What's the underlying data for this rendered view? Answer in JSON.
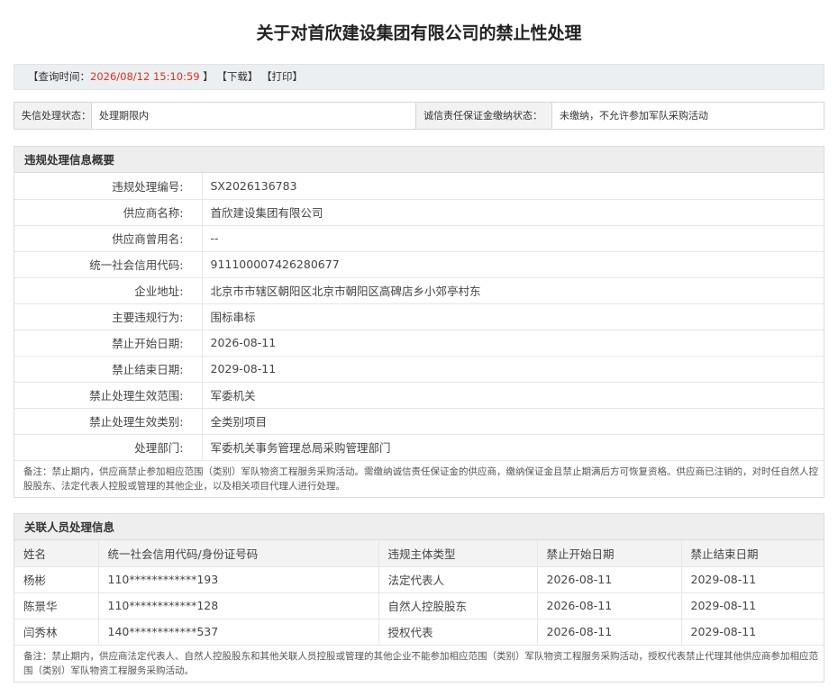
{
  "title": "关于对首欣建设集团有限公司的禁止性处理",
  "query_bar": {
    "prefix": "【查询时间：",
    "time": "2026/08/12 15:10:59",
    "suffix": "】",
    "download": "【下载】",
    "print": "【打印】"
  },
  "status": {
    "label1": "失信处理状态：",
    "value1": "处理期限内",
    "label2": "诚信责任保证金缴纳状态：",
    "value2": "未缴纳，不允许参加军队采购活动"
  },
  "summary": {
    "heading": "违规处理信息概要",
    "rows": [
      {
        "label": "违规处理编号:",
        "value": "SX2026136783"
      },
      {
        "label": "供应商名称:",
        "value": "首欣建设集团有限公司"
      },
      {
        "label": "供应商曾用名:",
        "value": "--"
      },
      {
        "label": "统一社会信用代码:",
        "value": "911100007426280677"
      },
      {
        "label": "企业地址:",
        "value": "北京市市辖区朝阳区北京市朝阳区高碑店乡小郊亭村东"
      },
      {
        "label": "主要违规行为:",
        "value": "围标串标"
      },
      {
        "label": "禁止开始日期:",
        "value": "2026-08-11"
      },
      {
        "label": "禁止结束日期:",
        "value": "2029-08-11"
      },
      {
        "label": "禁止处理生效范围:",
        "value": "军委机关"
      },
      {
        "label": "禁止处理生效类别:",
        "value": "全类别项目"
      },
      {
        "label": "处理部门:",
        "value": "军委机关事务管理总局采购管理部门"
      }
    ],
    "note": "备注：禁止期内，供应商禁止参加相应范围（类别）军队物资工程服务采购活动。需缴纳诚信责任保证金的供应商，缴纳保证金且禁止期满后方可恢复资格。供应商已注销的，对时任自然人控股股东、法定代表人控股或管理的其他企业，以及相关项目代理人进行处理。"
  },
  "related": {
    "heading": "关联人员处理信息",
    "columns": [
      "姓名",
      "统一社会信用代码/身份证号码",
      "违规主体类型",
      "禁止开始日期",
      "禁止结束日期"
    ],
    "rows": [
      [
        "杨彬",
        "110************193",
        "法定代表人",
        "2026-08-11",
        "2029-08-11"
      ],
      [
        "陈景华",
        "110************128",
        "自然人控股股东",
        "2026-08-11",
        "2029-08-11"
      ],
      [
        "闫秀林",
        "140************537",
        "授权代表",
        "2026-08-11",
        "2029-08-11"
      ]
    ],
    "note": "备注：禁止期内，供应商法定代表人、自然人控股股东和其他关联人员控股或管理的其他企业不能参加相应范围（类别）军队物资工程服务采购活动，授权代表禁止代理其他供应商参加相应范围（类别）军队物资工程服务采购活动。"
  },
  "colors": {
    "time": "#e0301e",
    "header_bg": "#eeeeee",
    "bar_bg": "#eceff2"
  }
}
